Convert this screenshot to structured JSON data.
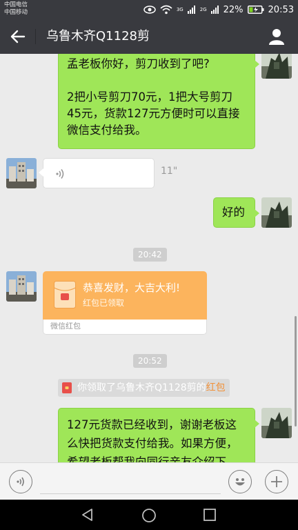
{
  "status_bar": {
    "carrier_1": "中国电信",
    "carrier_2": "中国移动",
    "net_1": "3G",
    "net_2": "2G",
    "battery": "22%",
    "time": "20:53"
  },
  "header": {
    "title": "乌鲁木齐Q1128剪"
  },
  "messages": {
    "m1_line1": "孟老板你好，剪刀收到了吧?",
    "m1_line2": "2把小号剪刀70元，1把大号剪刀",
    "m1_line3": "45元，货款127元方便时可以直接",
    "m1_line4": "微信支付给我。",
    "voice_duration": "11\"",
    "m2": "好的",
    "time_1": "20:42",
    "redpacket_wish": "恭喜发财，大吉大利!",
    "redpacket_status": "红包已领取",
    "redpacket_footer": "微信红包",
    "time_2": "20:52",
    "sys_prefix": "你领取了乌鲁木齐Q1128剪的",
    "sys_highlight": "红包",
    "m3_line1": "127元货款已经收到，谢谢老板这",
    "m3_line2": "么快把货款支付给我。如果方便，",
    "m3_line3": "希望老板帮我向同行亲友介绍下。"
  },
  "colors": {
    "header_bg": "#393a3f",
    "bubble_out": "#9fe658",
    "redpacket": "#fcb45d",
    "highlight": "#f29138"
  }
}
